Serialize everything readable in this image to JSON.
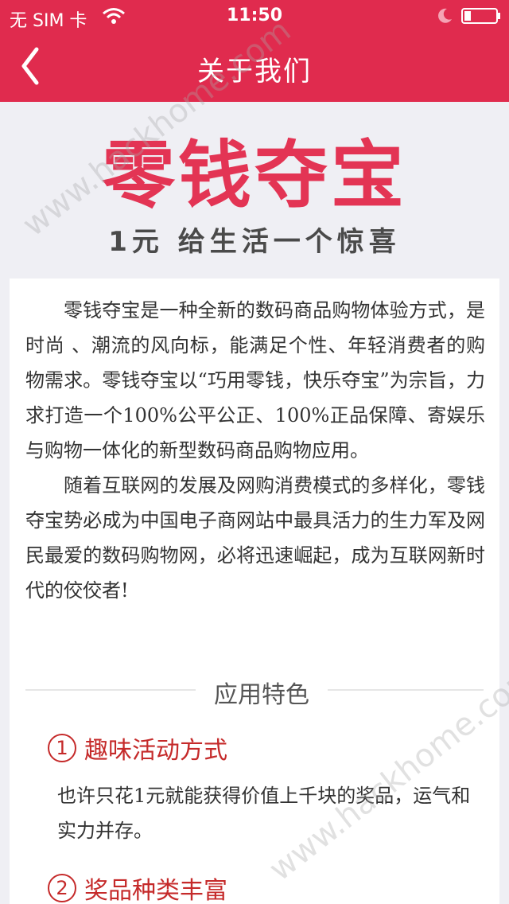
{
  "status_bar": {
    "carrier": "无 SIM 卡",
    "time": "11:50"
  },
  "nav": {
    "title": "关于我们"
  },
  "logo": {
    "main": "零钱夺宝",
    "slogan": "1元 给生活一个惊喜"
  },
  "intro": {
    "paragraphs": [
      "零钱夺宝是一种全新的数码商品购物体验方式，是时尚 、潮流的风向标，能满足个性、年轻消费者的购物需求。零钱夺宝以“巧用零钱，快乐夺宝”为宗旨，力求打造一个100%公平公正、100%正品保障、寄娱乐与购物一体化的新型数码商品购物应用。",
      "随着互联网的发展及网购消费模式的多样化，零钱夺宝势必成为中国电子商网站中最具活力的生力军及网民最爱的数码购物网，必将迅速崛起，成为互联网新时代的佼佼者!"
    ]
  },
  "features": {
    "heading": "应用特色",
    "items": [
      {
        "number": "1",
        "title": "趣味活动方式",
        "description": "也许只花1元就能获得价值上千块的奖品，运气和实力并存。"
      },
      {
        "number": "2",
        "title": "奖品种类丰富"
      }
    ]
  },
  "watermark": "www.hackhome.com",
  "colors": {
    "brand_red": "#e02b4e",
    "logo_red": "#e33454",
    "feature_red": "#c52a2a",
    "background": "#efeff4"
  }
}
